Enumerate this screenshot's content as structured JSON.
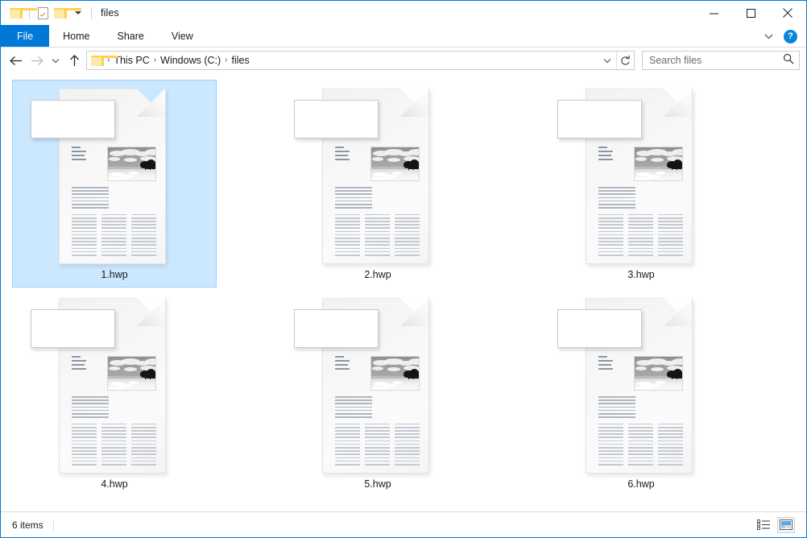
{
  "window": {
    "title": "files",
    "quick_access": [
      {
        "name": "folder-icon",
        "tooltip": "Folder"
      },
      {
        "name": "properties-icon",
        "tooltip": "Properties"
      },
      {
        "name": "new-folder-icon",
        "tooltip": "New folder"
      },
      {
        "name": "customize-chevron-icon",
        "tooltip": "Customize Quick Access Toolbar"
      }
    ],
    "controls": {
      "minimize": "Minimize",
      "maximize": "Maximize",
      "close": "Close"
    }
  },
  "ribbon": {
    "tabs": [
      {
        "label": "File",
        "active": true
      },
      {
        "label": "Home",
        "active": false
      },
      {
        "label": "Share",
        "active": false
      },
      {
        "label": "View",
        "active": false
      }
    ],
    "expand_label": "Expand Ribbon",
    "help_label": "?"
  },
  "nav": {
    "back": "Back",
    "forward": "Forward",
    "recent": "Recent locations",
    "up": "Up",
    "breadcrumb": [
      "This PC",
      "Windows (C:)",
      "files"
    ],
    "breadcrumb_separator": "›",
    "dropdown": "Previous locations",
    "refresh": "Refresh"
  },
  "search": {
    "placeholder": "Search files",
    "value": "",
    "icon": "search-icon"
  },
  "files": [
    {
      "name": "1.hwp",
      "selected": true
    },
    {
      "name": "2.hwp",
      "selected": false
    },
    {
      "name": "3.hwp",
      "selected": false
    },
    {
      "name": "4.hwp",
      "selected": false
    },
    {
      "name": "5.hwp",
      "selected": false
    },
    {
      "name": "6.hwp",
      "selected": false
    }
  ],
  "status": {
    "item_count": "6 items",
    "views": [
      {
        "name": "details-view-button",
        "active": false
      },
      {
        "name": "large-icons-view-button",
        "active": true
      }
    ]
  },
  "colors": {
    "accent": "#0078d7",
    "selection_fill": "#cce8ff",
    "selection_border": "#99d1ff",
    "folder_yellow": "#ffd04b",
    "help_blue": "#0a84d8"
  }
}
